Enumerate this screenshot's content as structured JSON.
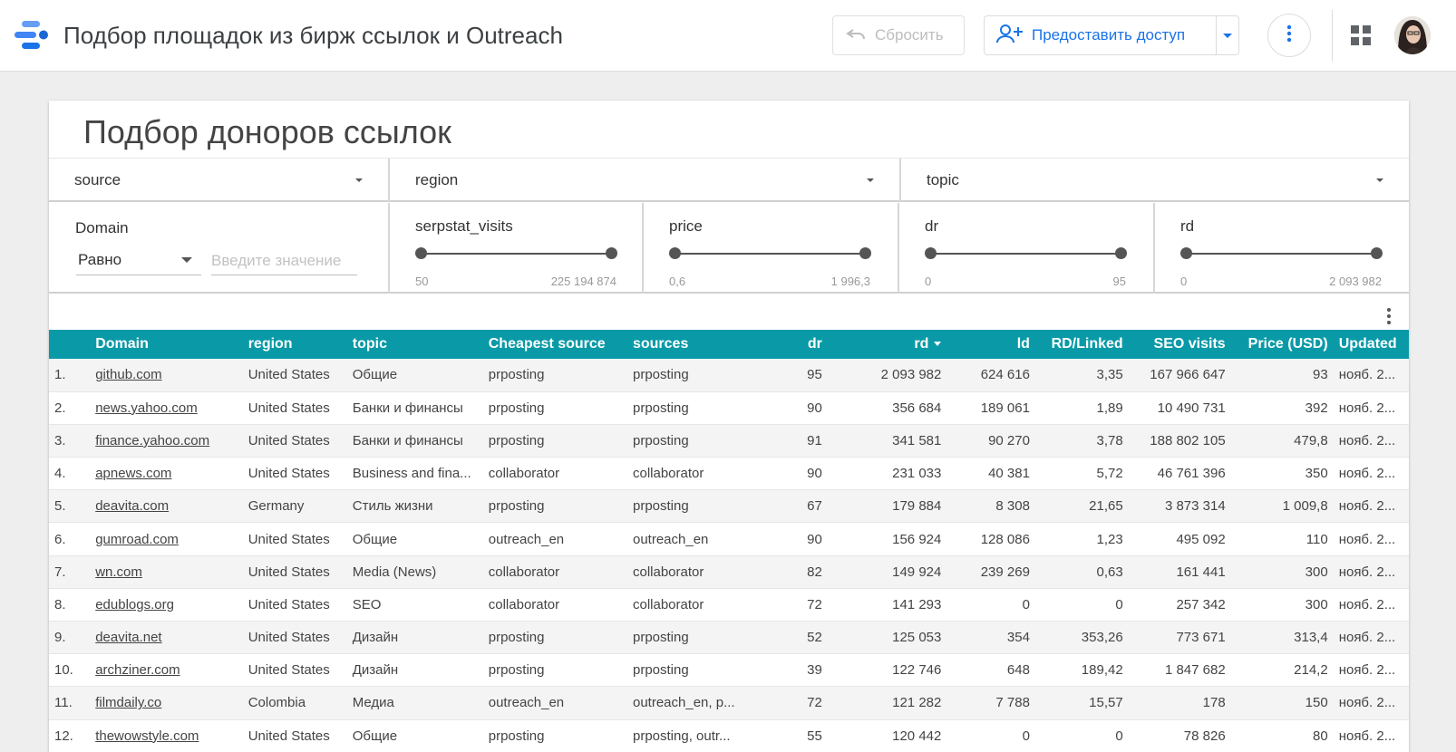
{
  "header": {
    "title": "Подбор площадок из бирж ссылок и Outreach",
    "reset_label": "Сбросить",
    "share_label": "Предоставить доступ",
    "logo_icon": "looker-studio-logo-icon",
    "accent_color": "#1a73e8"
  },
  "report": {
    "title": "Подбор доноров ссылок",
    "filters": {
      "source": "source",
      "region": "region",
      "topic": "topic"
    },
    "domain_filter": {
      "label": "Domain",
      "operator": "Равно",
      "placeholder": "Введите значение"
    },
    "sliders": [
      {
        "label": "serpstat_visits",
        "min": "50",
        "max": "225 194 874"
      },
      {
        "label": "price",
        "min": "0,6",
        "max": "1 996,3"
      },
      {
        "label": "dr",
        "min": "0",
        "max": "95"
      },
      {
        "label": "rd",
        "min": "0",
        "max": "2 093 982"
      }
    ]
  },
  "table": {
    "header_color": "#0a9aa7",
    "columns": [
      "Domain",
      "region",
      "topic",
      "Cheapest source",
      "sources",
      "dr",
      "rd",
      "ld",
      "RD/Linked",
      "SEO visits",
      "Price (USD)",
      "Updated"
    ],
    "sort_column": "rd",
    "sort_direction": "desc",
    "rows": [
      [
        "1.",
        "github.com",
        "United States",
        "Общие",
        "prposting",
        "prposting",
        "95",
        "2 093 982",
        "624 616",
        "3,35",
        "167 966 647",
        "93",
        "нояб. 2..."
      ],
      [
        "2.",
        "news.yahoo.com",
        "United States",
        "Банки и финансы",
        "prposting",
        "prposting",
        "90",
        "356 684",
        "189 061",
        "1,89",
        "10 490 731",
        "392",
        "нояб. 2..."
      ],
      [
        "3.",
        "finance.yahoo.com",
        "United States",
        "Банки и финансы",
        "prposting",
        "prposting",
        "91",
        "341 581",
        "90 270",
        "3,78",
        "188 802 105",
        "479,8",
        "нояб. 2..."
      ],
      [
        "4.",
        "apnews.com",
        "United States",
        "Business and fina...",
        "collaborator",
        "collaborator",
        "90",
        "231 033",
        "40 381",
        "5,72",
        "46 761 396",
        "350",
        "нояб. 2..."
      ],
      [
        "5.",
        "deavita.com",
        "Germany",
        "Стиль жизни",
        "prposting",
        "prposting",
        "67",
        "179 884",
        "8 308",
        "21,65",
        "3 873 314",
        "1 009,8",
        "нояб. 2..."
      ],
      [
        "6.",
        "gumroad.com",
        "United States",
        "Общие",
        "outreach_en",
        "outreach_en",
        "90",
        "156 924",
        "128 086",
        "1,23",
        "495 092",
        "110",
        "нояб. 2..."
      ],
      [
        "7.",
        "wn.com",
        "United States",
        "Media (News)",
        "collaborator",
        "collaborator",
        "82",
        "149 924",
        "239 269",
        "0,63",
        "161 441",
        "300",
        "нояб. 2..."
      ],
      [
        "8.",
        "edublogs.org",
        "United States",
        "SEO",
        "collaborator",
        "collaborator",
        "72",
        "141 293",
        "0",
        "0",
        "257 342",
        "300",
        "нояб. 2..."
      ],
      [
        "9.",
        "deavita.net",
        "United States",
        "Дизайн",
        "prposting",
        "prposting",
        "52",
        "125 053",
        "354",
        "353,26",
        "773 671",
        "313,4",
        "нояб. 2..."
      ],
      [
        "10.",
        "archziner.com",
        "United States",
        "Дизайн",
        "prposting",
        "prposting",
        "39",
        "122 746",
        "648",
        "189,42",
        "1 847 682",
        "214,2",
        "нояб. 2..."
      ],
      [
        "11.",
        "filmdaily.co",
        "Colombia",
        "Медиа",
        "outreach_en",
        "outreach_en, p...",
        "72",
        "121 282",
        "7 788",
        "15,57",
        "178",
        "150",
        "нояб. 2..."
      ],
      [
        "12.",
        "thewowstyle.com",
        "United States",
        "Общие",
        "prposting",
        "prposting, outr...",
        "55",
        "120 442",
        "0",
        "0",
        "78 826",
        "80",
        "нояб. 2..."
      ]
    ]
  }
}
